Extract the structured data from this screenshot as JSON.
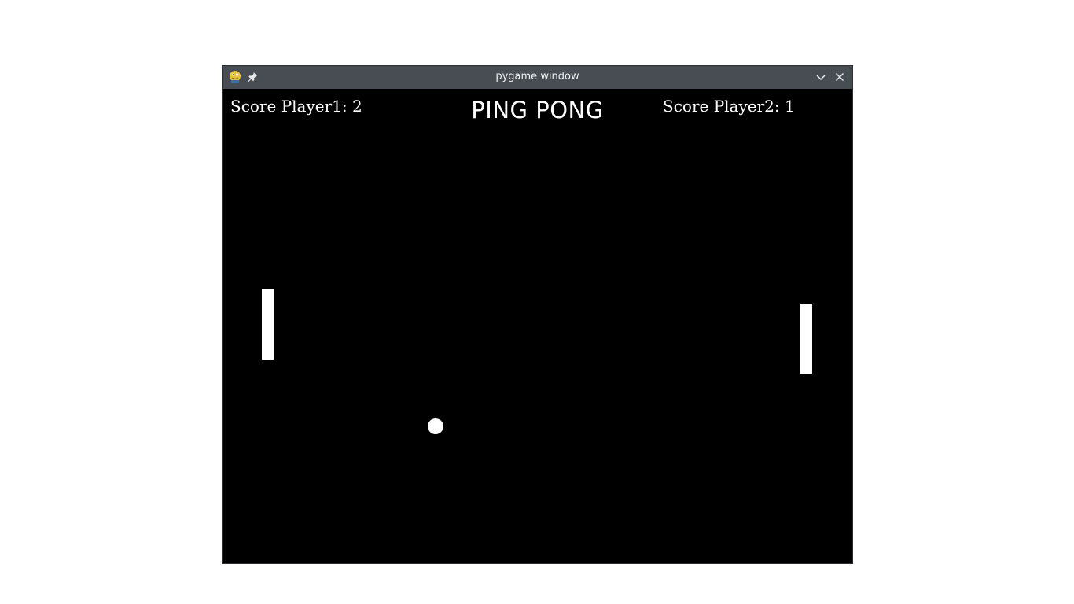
{
  "window": {
    "title": "pygame window"
  },
  "icons": {
    "app": "pygame-snake-icon",
    "pin": "pin-icon",
    "minimize": "chevron-down-icon",
    "close": "close-icon"
  },
  "game": {
    "title": "PING PONG",
    "score_player1": "Score Player1: 2",
    "score_player2": "Score Player2: 1"
  },
  "colors": {
    "background": "#000000",
    "foreground": "#ffffff",
    "titlebar": "#474d53"
  }
}
